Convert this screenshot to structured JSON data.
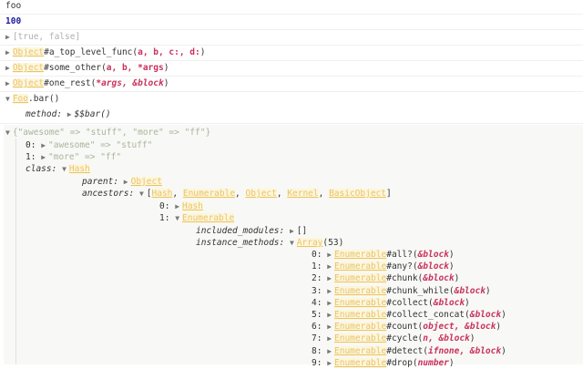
{
  "lines": {
    "foo": "foo",
    "num": "100",
    "arr": "[true, false]",
    "f1": {
      "cls": "Object",
      "name": "#a_top_level_func(",
      "args": "a, b, c:, d:",
      ")": ")"
    },
    "f2": {
      "cls": "Object",
      "name": "#some_other(",
      "args": "a, b, *args"
    },
    "f3": {
      "cls": "Object",
      "name": "#one_rest(",
      "args": "*args, &block"
    },
    "foo_cls": "Foo",
    "foo_rest": ".bar()",
    "method_key": "method:",
    "method_val": "$$bar()",
    "hash": "{\"awesome\" => \"stuff\", \"more\" => \"ff\"}",
    "h0k": "0:",
    "h0": "\"awesome\" => \"stuff\"",
    "h1k": "1:",
    "h1": "\"more\" => \"ff\"",
    "class_key": "class:",
    "class_val": "Hash",
    "parent_key": "parent:",
    "parent_val": "Object",
    "anc_key": "ancestors:",
    "anc": [
      "Hash",
      "Enumerable",
      "Object",
      "Kernel",
      "BasicObject"
    ],
    "a0k": "0:",
    "a0": "Hash",
    "a1k": "1:",
    "a1": "Enumerable",
    "inc_key": "included_modules:",
    "inc_val": "[]",
    "im_key": "instance_methods:",
    "im_cls": "Array",
    "im_count": "(53)"
  },
  "methods": [
    {
      "i": "0:",
      "cls": "Enumerable",
      "name": "#all?",
      "args": "&block"
    },
    {
      "i": "1:",
      "cls": "Enumerable",
      "name": "#any?",
      "args": "&block"
    },
    {
      "i": "2:",
      "cls": "Enumerable",
      "name": "#chunk",
      "args": "&block"
    },
    {
      "i": "3:",
      "cls": "Enumerable",
      "name": "#chunk_while",
      "args": "&block"
    },
    {
      "i": "4:",
      "cls": "Enumerable",
      "name": "#collect",
      "args": "&block"
    },
    {
      "i": "5:",
      "cls": "Enumerable",
      "name": "#collect_concat",
      "args": "&block"
    },
    {
      "i": "6:",
      "cls": "Enumerable",
      "name": "#count",
      "args": "object, &block"
    },
    {
      "i": "7:",
      "cls": "Enumerable",
      "name": "#cycle",
      "args": "n, &block"
    },
    {
      "i": "8:",
      "cls": "Enumerable",
      "name": "#detect",
      "args": "ifnone, &block"
    },
    {
      "i": "9:",
      "cls": "Enumerable",
      "name": "#drop",
      "args": "number"
    }
  ]
}
